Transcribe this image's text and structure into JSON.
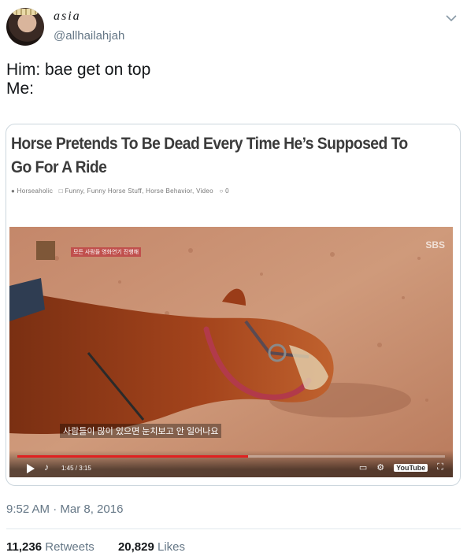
{
  "user": {
    "display_name": "asia",
    "handle": "@allhailahjah"
  },
  "tweet": {
    "line1": "Him: bae get on top",
    "line2": "Me:"
  },
  "card": {
    "title": "Horse Pretends To Be Dead Every Time He’s Supposed To Go For A Ride",
    "author": "Horseaholic",
    "categories": "Funny, Funny Horse Stuff, Horse Behavior, Video",
    "comments": "0",
    "video": {
      "badge": "모든 사람들 영화연기 진행해",
      "watermark": "SBS",
      "subtitle": "사람들이 많이 있으면 눈치보고 안 일어나요",
      "time": "1:45 / 3:15",
      "progress": 0.54,
      "youtube_label": "YouTube"
    }
  },
  "meta": {
    "timestamp": "9:52 AM · Mar 8, 2016",
    "retweets_count": "11,236",
    "retweets_label": "Retweets",
    "likes_count": "20,829",
    "likes_label": "Likes"
  },
  "icons": {
    "avatar": "avatar",
    "menu": "chevron-down-icon",
    "user": "user-icon",
    "folder": "folder-icon",
    "comment": "comment-icon",
    "play": "play-icon",
    "volume": "volume-icon",
    "settings": "gear-icon",
    "fullscreen": "fullscreen-icon"
  },
  "colors": {
    "text": "#14171a",
    "secondary": "#657786",
    "border": "#ccd6dd",
    "progress": "#e02020"
  }
}
